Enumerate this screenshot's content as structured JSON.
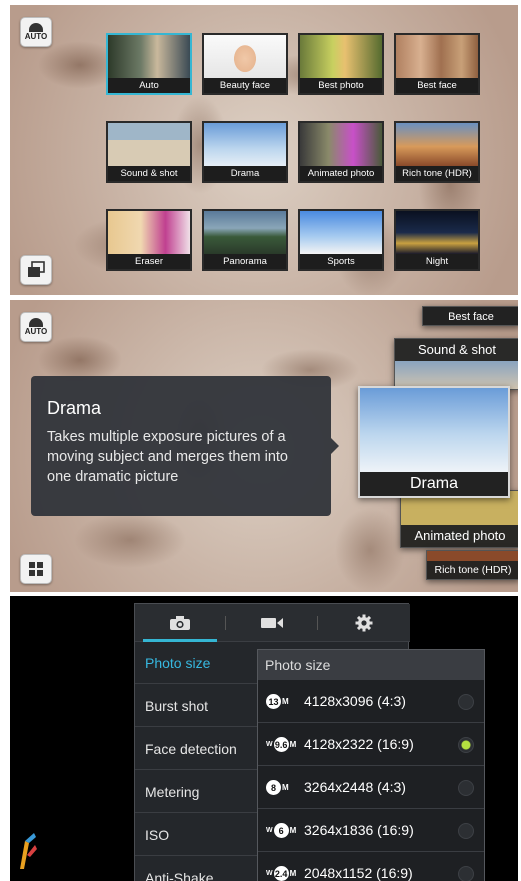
{
  "top_panel": {
    "auto_button_label": "AUTO",
    "modes": [
      {
        "label": "Auto",
        "selected": true
      },
      {
        "label": "Beauty face",
        "selected": false
      },
      {
        "label": "Best photo",
        "selected": false
      },
      {
        "label": "Best face",
        "selected": false
      },
      {
        "label": "Sound & shot",
        "selected": false
      },
      {
        "label": "Drama",
        "selected": false
      },
      {
        "label": "Animated photo",
        "selected": false
      },
      {
        "label": "Rich tone (HDR)",
        "selected": false
      },
      {
        "label": "Eraser",
        "selected": false
      },
      {
        "label": "Panorama",
        "selected": false
      },
      {
        "label": "Sports",
        "selected": false
      },
      {
        "label": "Night",
        "selected": false
      }
    ]
  },
  "middle_panel": {
    "auto_button_label": "AUTO",
    "tooltip": {
      "title": "Drama",
      "description": "Takes multiple exposure pictures of a moving subject and merges them into one dramatic picture"
    },
    "carousel": {
      "best_face": "Best face",
      "sound_and_shot": "Sound & shot",
      "drama": "Drama",
      "animated_photo": "Animated photo",
      "rich_tone": "Rich tone (HDR)"
    }
  },
  "settings": {
    "tabs": [
      "camera-icon",
      "video-icon",
      "gear-icon"
    ],
    "active_color": "#35b6d3",
    "menu": [
      "Photo size",
      "Burst shot",
      "Face detection",
      "Metering",
      "ISO",
      "Anti-Shake"
    ],
    "active_menu_item": "Photo size",
    "submenu": {
      "title": "Photo size",
      "options": [
        {
          "badge": "13",
          "wide": false,
          "label": "4128x3096 (4:3)",
          "selected": false
        },
        {
          "badge": "9.6",
          "wide": true,
          "label": "4128x2322 (16:9)",
          "selected": true
        },
        {
          "badge": "8",
          "wide": false,
          "label": "3264x2448 (4:3)",
          "selected": false
        },
        {
          "badge": "6",
          "wide": true,
          "label": "3264x1836 (16:9)",
          "selected": false
        },
        {
          "badge": "2.4",
          "wide": true,
          "label": "2048x1152 (16:9)",
          "selected": false
        }
      ],
      "badge_unit": "M",
      "wide_prefix": "W",
      "selected_color": "#b4e040"
    }
  }
}
